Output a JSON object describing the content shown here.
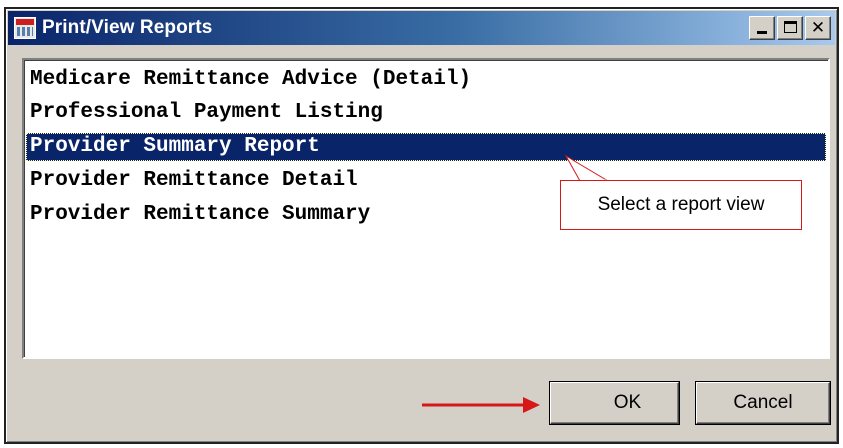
{
  "window": {
    "title": "Print/View Reports"
  },
  "reports": {
    "items": [
      "Medicare Remittance Advice (Detail)",
      "Professional Payment Listing",
      "Provider Summary Report",
      "Provider Remittance Detail",
      "Provider Remittance Summary"
    ],
    "selected": "Provider Summary Report"
  },
  "annotation": {
    "callout_text": "Select a report view"
  },
  "buttons": {
    "ok_label": "OK",
    "cancel_label": "Cancel"
  },
  "colors": {
    "title_bar": "#0a246a",
    "selection": "#0a246a",
    "annotation_red": "#d61818",
    "face": "#d4d0c8"
  },
  "icons": {
    "app": "report-app-icon",
    "minimize": "minimize-icon",
    "maximize": "maximize-icon",
    "close": "close-icon",
    "pointer": "red-arrow-icon"
  }
}
